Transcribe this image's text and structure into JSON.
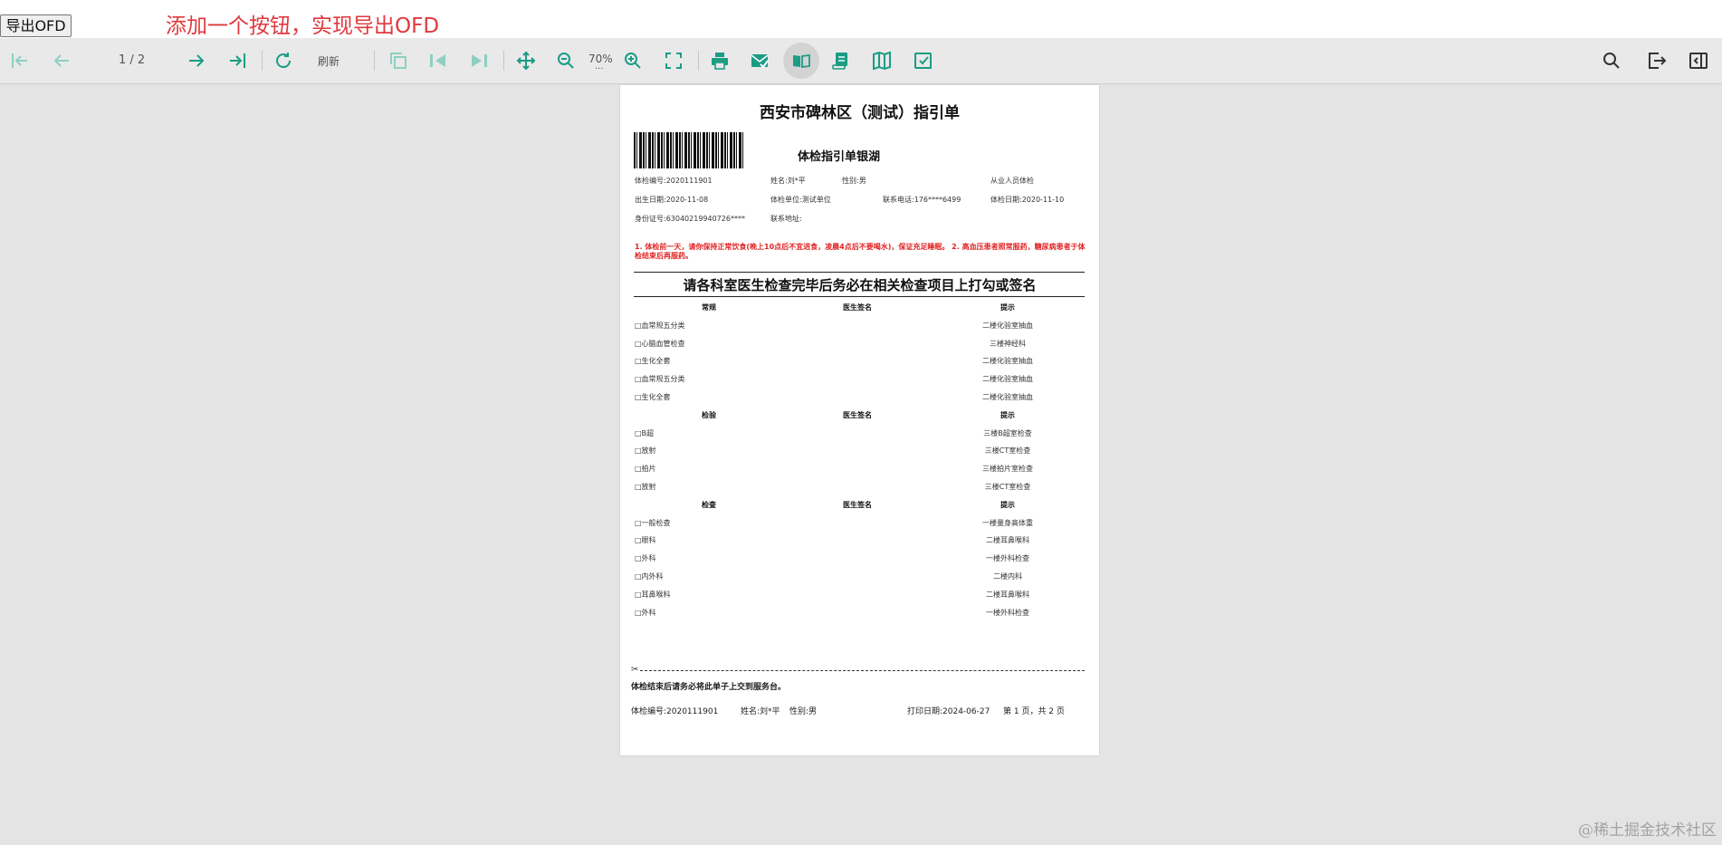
{
  "app": {
    "export_button": "导出OFD",
    "annotation": "添加一个按钮，实现导出OFD",
    "watermark": "@稀土掘金技术社区"
  },
  "toolbar": {
    "page_indicator": "1 / 2",
    "refresh_label": "刷新",
    "zoom_level": "70%",
    "zoom_more": "...",
    "accent_color": "#1a9d84",
    "disabled_color": "#8ecfc2"
  },
  "document": {
    "title": "西安市碑林区（测试）指引单",
    "subtitle": "体检指引单银湖",
    "info": {
      "exam_no": "体检编号:2020111901",
      "name": "姓名:刘*平",
      "gender": "性别:男",
      "category": "从业人员体检",
      "birth": "出生日期:2020-11-08",
      "unit": "体检单位:测试单位",
      "phone": "联系电话:176****6499",
      "exam_date": "体检日期:2020-11-10",
      "id_no": "身份证号:63040219940726****",
      "address": "联系地址:"
    },
    "notice": "1. 体检前一天，请你保持正常饮食(晚上10点后不宜进食，凌晨4点后不要喝水)，保证充足睡眠。 2. 高血压患者照常服药，糖尿病患者于体检结束后再服药。",
    "banner": "请各科室医生检查完毕后务必在相关检查项目上打勾或签名",
    "sections": [
      {
        "heading": "常规",
        "sign_heading": "医生签名",
        "tip_heading": "提示",
        "items": [
          {
            "name": "□血常规五分类",
            "tip": "二楼化验室抽血"
          },
          {
            "name": "□心脑血管检查",
            "tip": "三楼神经科"
          },
          {
            "name": "□生化全套",
            "tip": "二楼化验室抽血"
          },
          {
            "name": "□血常规五分类",
            "tip": "二楼化验室抽血"
          },
          {
            "name": "□生化全套",
            "tip": "二楼化验室抽血"
          }
        ]
      },
      {
        "heading": "检验",
        "sign_heading": "医生签名",
        "tip_heading": "提示",
        "items": [
          {
            "name": "□B超",
            "tip": "三楼B超室检查"
          },
          {
            "name": "□放射",
            "tip": "三楼CT室检查"
          },
          {
            "name": "□拍片",
            "tip": "三楼拍片室检查"
          },
          {
            "name": "□放射",
            "tip": "三楼CT室检查"
          }
        ]
      },
      {
        "heading": "检查",
        "sign_heading": "医生签名",
        "tip_heading": "提示",
        "items": [
          {
            "name": "□一般检查",
            "tip": "一楼量身高体重"
          },
          {
            "name": "□眼科",
            "tip": "二楼耳鼻喉科"
          },
          {
            "name": "□外科",
            "tip": "一楼外科检查"
          },
          {
            "name": "□内外科",
            "tip": "二楼内科"
          },
          {
            "name": "□耳鼻喉科",
            "tip": "二楼耳鼻喉科"
          },
          {
            "name": "□外科",
            "tip": "一楼外科检查"
          }
        ]
      }
    ],
    "footer": {
      "notice": "体检结束后请务必将此单子上交到服务台。",
      "exam_no": "体检编号:2020111901",
      "name": "姓名:刘*平",
      "gender": "性别:男",
      "print_date": "打印日期:2024-06-27",
      "page_info": "第 1 页，共 2 页"
    }
  }
}
